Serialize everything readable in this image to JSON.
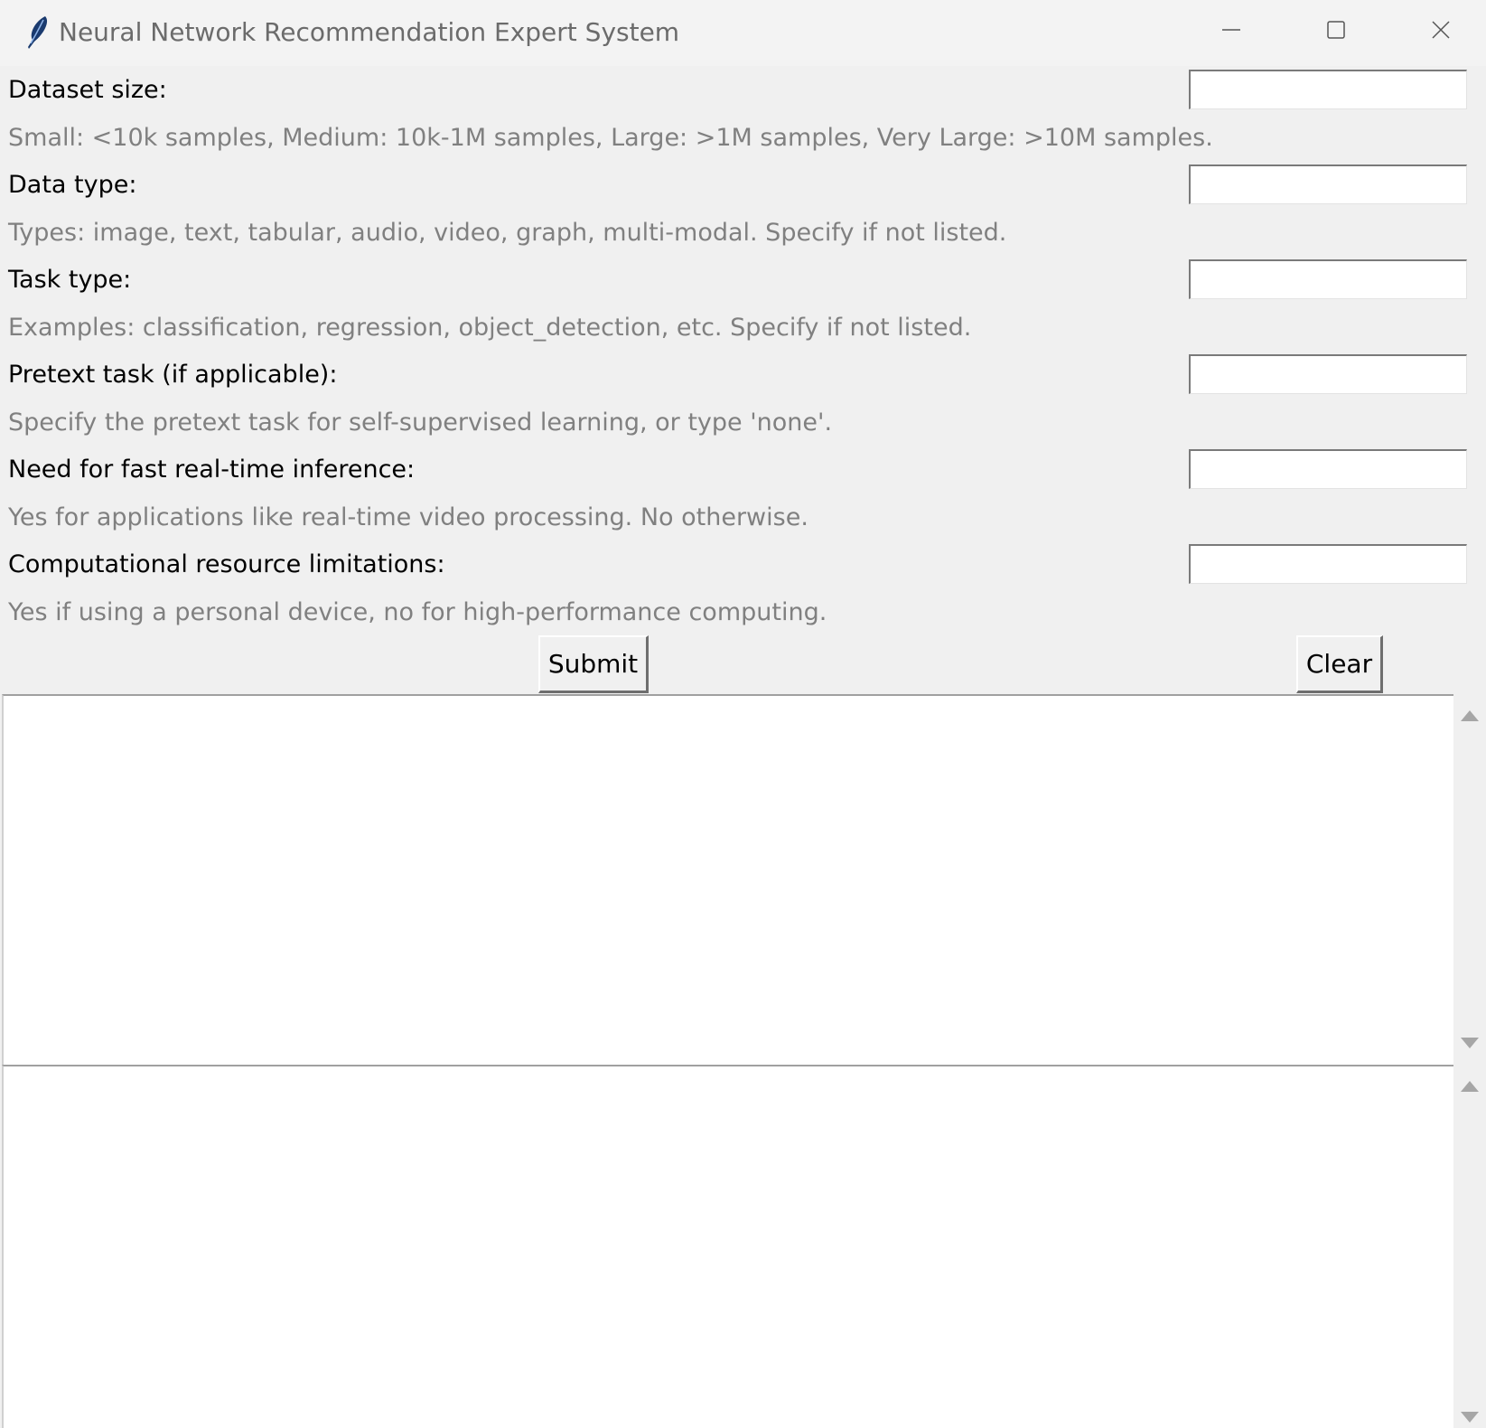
{
  "window": {
    "title": "Neural Network Recommendation Expert System"
  },
  "form": {
    "fields": [
      {
        "label": "Dataset size:",
        "hint": "Small: <10k samples, Medium: 10k-1M samples, Large: >1M samples, Very Large: >10M samples.",
        "value": ""
      },
      {
        "label": "Data type:",
        "hint": "Types: image, text, tabular, audio, video, graph, multi-modal. Specify if not listed.",
        "value": ""
      },
      {
        "label": "Task type:",
        "hint": "Examples: classification, regression, object_detection, etc. Specify if not listed.",
        "value": ""
      },
      {
        "label": "Pretext task (if applicable):",
        "hint": "Specify the pretext task for self-supervised learning, or type 'none'.",
        "value": ""
      },
      {
        "label": "Need for fast real-time inference:",
        "hint": "Yes for applications like real-time video processing. No otherwise.",
        "value": ""
      },
      {
        "label": "Computational resource limitations:",
        "hint": "Yes if using a personal device, no for high-performance computing.",
        "value": ""
      }
    ]
  },
  "buttons": {
    "submit": "Submit",
    "clear": "Clear"
  },
  "output": {
    "text": ""
  },
  "log": {
    "text": ""
  },
  "colors": {
    "background": "#f0f0f0",
    "hint_text": "#808080",
    "label_text": "#000000"
  }
}
